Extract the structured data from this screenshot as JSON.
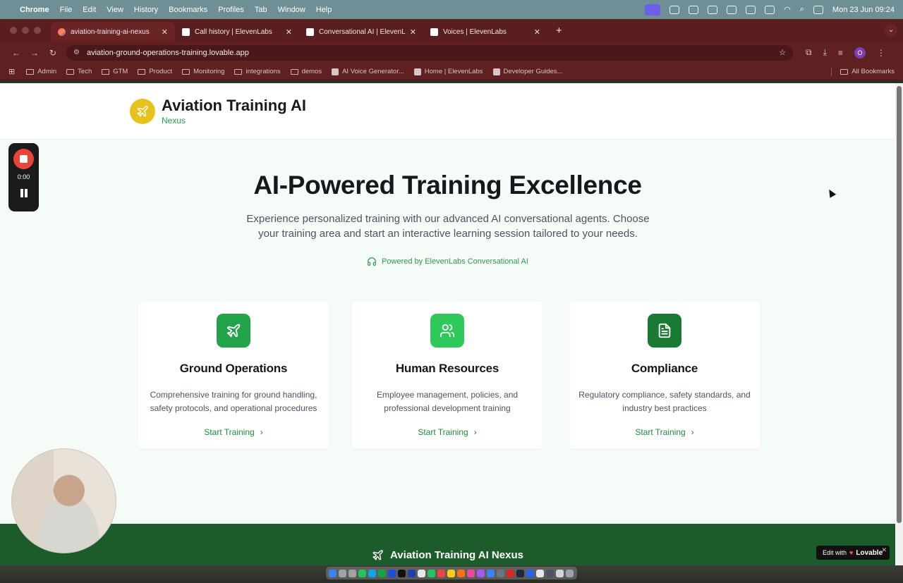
{
  "menubar": {
    "app": "Chrome",
    "items": [
      "File",
      "Edit",
      "View",
      "History",
      "Bookmarks",
      "Profiles",
      "Tab",
      "Window",
      "Help"
    ],
    "clock": "Mon 23 Jun  09:24"
  },
  "tabs": [
    {
      "title": "aviation-training-ai-nexus",
      "active": true
    },
    {
      "title": "Call history | ElevenLabs",
      "active": false
    },
    {
      "title": "Conversational AI | ElevenLabs",
      "active": false
    },
    {
      "title": "Voices | ElevenLabs",
      "active": false
    }
  ],
  "address": {
    "url": "aviation-ground-operations-training.lovable.app"
  },
  "profile_initial": "O",
  "bookmarks": {
    "items": [
      {
        "label": "Admin",
        "type": "folder"
      },
      {
        "label": "Tech",
        "type": "folder"
      },
      {
        "label": "GTM",
        "type": "folder"
      },
      {
        "label": "Product",
        "type": "folder"
      },
      {
        "label": "Monitoring",
        "type": "folder"
      },
      {
        "label": "integrations",
        "type": "folder"
      },
      {
        "label": "demos",
        "type": "folder"
      },
      {
        "label": "AI Voice Generator...",
        "type": "link"
      },
      {
        "label": "Home | ElevenLabs",
        "type": "link"
      },
      {
        "label": "Developer Guides...",
        "type": "link"
      }
    ],
    "all": "All Bookmarks"
  },
  "site": {
    "brand_title": "Aviation Training AI",
    "brand_sub": "Nexus",
    "hero_title": "AI-Powered Training Excellence",
    "hero_text": "Experience personalized training with our advanced AI conversational agents. Choose your training area and start an interactive learning session tailored to your needs.",
    "powered": "Powered by ElevenLabs Conversational AI",
    "cards": [
      {
        "title": "Ground Operations",
        "desc": "Comprehensive training for ground handling, safety protocols, and operational procedures",
        "cta": "Start Training",
        "icon": "plane-icon",
        "color": "#22a34a"
      },
      {
        "title": "Human Resources",
        "desc": "Employee management, policies, and professional development training",
        "cta": "Start Training",
        "icon": "users-icon",
        "color": "#2ec95a"
      },
      {
        "title": "Compliance",
        "desc": "Regulatory compliance, safety standards, and industry best practices",
        "cta": "Start Training",
        "icon": "document-icon",
        "color": "#1a7a34"
      }
    ],
    "footer_title": "Aviation Training AI Nexus"
  },
  "recorder": {
    "time": "0:00"
  },
  "edit_badge": {
    "prefix": "Edit with",
    "brand": "Lovable"
  },
  "colors": {
    "accent_green": "#1f8b3f",
    "brand_yellow": "#e8c21c",
    "footer_green": "#1c5c2a"
  }
}
